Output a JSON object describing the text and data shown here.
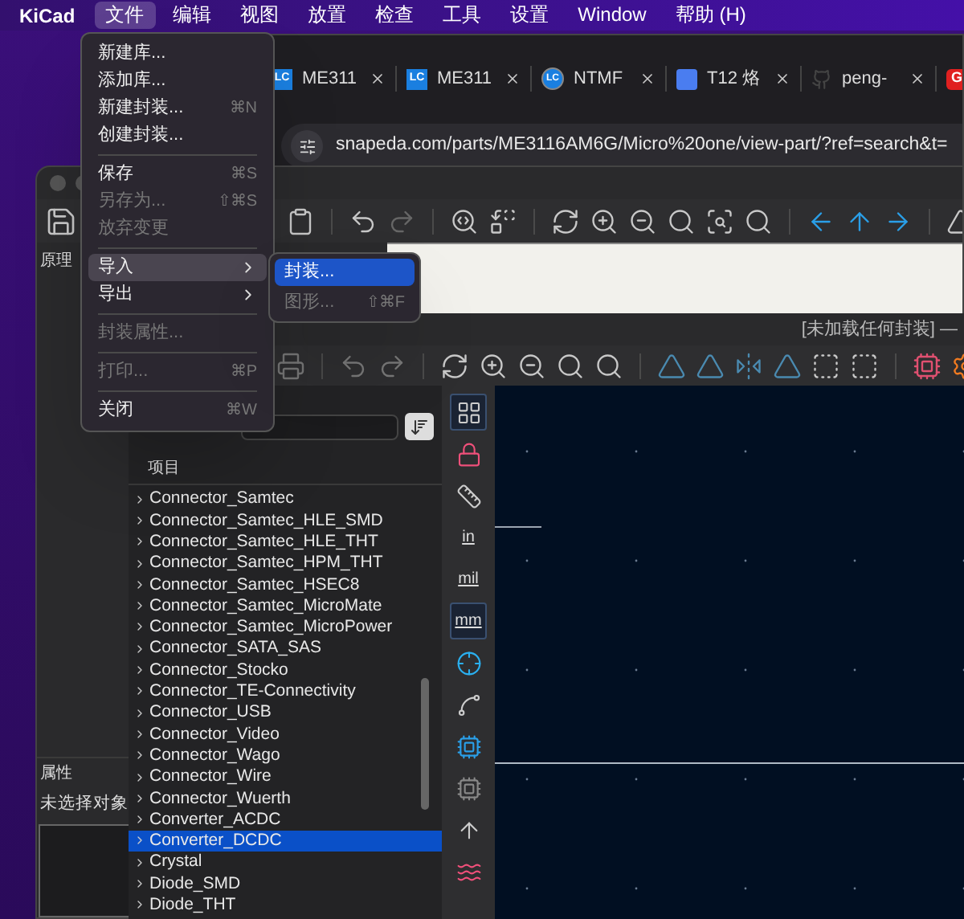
{
  "menu_bar": {
    "app": "KiCad",
    "items": [
      {
        "label": "文件",
        "selected": true
      },
      {
        "label": "编辑",
        "selected": false
      },
      {
        "label": "视图",
        "selected": false
      },
      {
        "label": "放置",
        "selected": false
      },
      {
        "label": "检查",
        "selected": false
      },
      {
        "label": "工具",
        "selected": false
      },
      {
        "label": "设置",
        "selected": false
      },
      {
        "label": "Window",
        "selected": false
      },
      {
        "label": "帮助 (H)",
        "selected": false
      }
    ]
  },
  "browser": {
    "tabs": [
      {
        "badge": "LC",
        "kind": "square",
        "label": "ME311"
      },
      {
        "badge": "LC",
        "kind": "square",
        "label": "ME311"
      },
      {
        "badge": "LC",
        "kind": "circle",
        "label": "NTMF"
      },
      {
        "kind": "logo",
        "label": "T12 烙"
      },
      {
        "kind": "avatar",
        "label": "peng-"
      },
      {
        "badge": "G",
        "kind": "red"
      }
    ],
    "address": "snapeda.com/parts/ME3116AM6G/Micro%20one/view-part/?ref=search&t="
  },
  "schematic_window": {
    "panel_label": "原理",
    "properties_label": "属性",
    "properties_value": "未选择对象"
  },
  "footprint_window": {
    "title": "[未加载任何封装] —",
    "column_header": "项目",
    "libraries": [
      {
        "name": "Connector_Samtec",
        "selected": false
      },
      {
        "name": "Connector_Samtec_HLE_SMD",
        "selected": false
      },
      {
        "name": "Connector_Samtec_HLE_THT",
        "selected": false
      },
      {
        "name": "Connector_Samtec_HPM_THT",
        "selected": false
      },
      {
        "name": "Connector_Samtec_HSEC8",
        "selected": false
      },
      {
        "name": "Connector_Samtec_MicroMate",
        "selected": false
      },
      {
        "name": "Connector_Samtec_MicroPower",
        "selected": false
      },
      {
        "name": "Connector_SATA_SAS",
        "selected": false
      },
      {
        "name": "Connector_Stocko",
        "selected": false
      },
      {
        "name": "Connector_TE-Connectivity",
        "selected": false
      },
      {
        "name": "Connector_USB",
        "selected": false
      },
      {
        "name": "Connector_Video",
        "selected": false
      },
      {
        "name": "Connector_Wago",
        "selected": false
      },
      {
        "name": "Connector_Wire",
        "selected": false
      },
      {
        "name": "Connector_Wuerth",
        "selected": false
      },
      {
        "name": "Converter_ACDC",
        "selected": false
      },
      {
        "name": "Converter_DCDC",
        "selected": true
      },
      {
        "name": "Crystal",
        "selected": false
      },
      {
        "name": "Diode_SMD",
        "selected": false
      },
      {
        "name": "Diode_THT",
        "selected": false
      }
    ],
    "units": [
      {
        "label": "in",
        "selected": false
      },
      {
        "label": "mil",
        "selected": false
      },
      {
        "label": "mm",
        "selected": true
      }
    ]
  },
  "file_menu": [
    {
      "kind": "item",
      "label": "新建库...",
      "disabled": false,
      "selected": false
    },
    {
      "kind": "item",
      "label": "添加库...",
      "disabled": false,
      "selected": false
    },
    {
      "kind": "item",
      "label": "新建封装...",
      "shortcut": "⌘N",
      "disabled": false,
      "selected": false
    },
    {
      "kind": "item",
      "label": "创建封装...",
      "disabled": false,
      "selected": false
    },
    {
      "kind": "separator"
    },
    {
      "kind": "item",
      "label": "保存",
      "shortcut": "⌘S",
      "disabled": false,
      "selected": false
    },
    {
      "kind": "item",
      "label": "另存为...",
      "shortcut": "⇧⌘S",
      "disabled": true,
      "selected": false
    },
    {
      "kind": "item",
      "label": "放弃变更",
      "disabled": true,
      "selected": false
    },
    {
      "kind": "separator"
    },
    {
      "kind": "submenu",
      "label": "导入",
      "disabled": false,
      "selected": true
    },
    {
      "kind": "submenu",
      "label": "导出",
      "disabled": false,
      "selected": false
    },
    {
      "kind": "separator"
    },
    {
      "kind": "item",
      "label": "封装属性...",
      "disabled": true,
      "selected": false
    },
    {
      "kind": "separator"
    },
    {
      "kind": "item",
      "label": "打印...",
      "shortcut": "⌘P",
      "disabled": true,
      "selected": false
    },
    {
      "kind": "separator"
    },
    {
      "kind": "item",
      "label": "关闭",
      "shortcut": "⌘W",
      "disabled": false,
      "selected": false
    }
  ],
  "import_submenu": [
    {
      "label": "封装...",
      "disabled": false,
      "selected": true
    },
    {
      "label": "图形...",
      "shortcut": "⇧⌘F",
      "disabled": true,
      "selected": false
    }
  ]
}
